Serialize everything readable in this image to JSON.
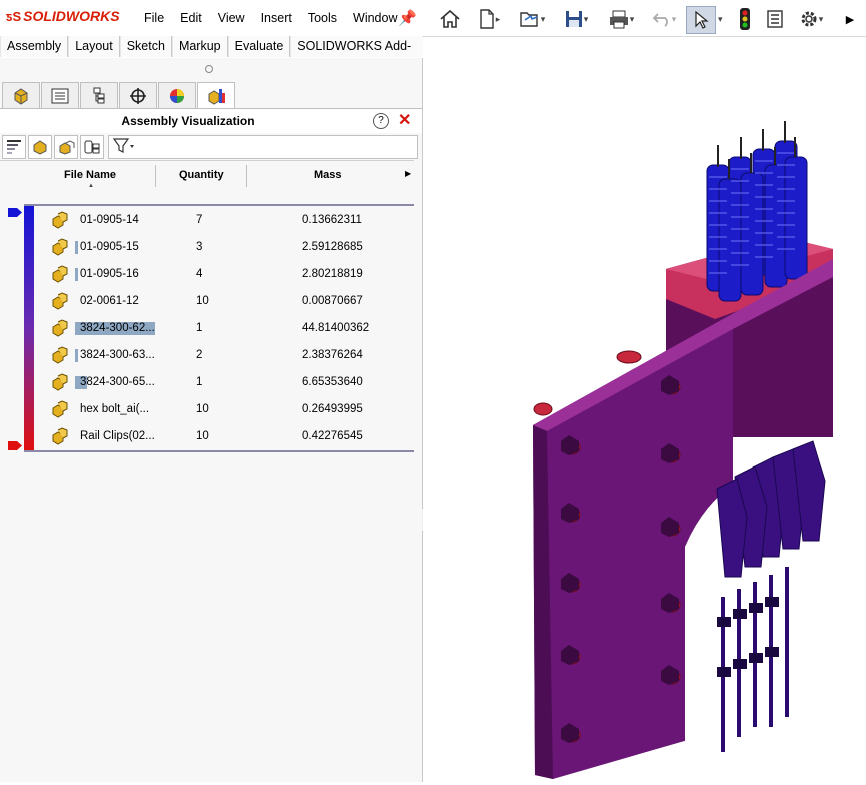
{
  "app": {
    "brand_prefix": "SOLID",
    "brand_suffix": "WORKS"
  },
  "menu": [
    "File",
    "Edit",
    "View",
    "Insert",
    "Tools",
    "Window"
  ],
  "command_tabs": [
    "Assembly",
    "Layout",
    "Sketch",
    "Markup",
    "Evaluate",
    "SOLIDWORKS Add-Ins"
  ],
  "toolbar_icons": [
    "home-icon",
    "new-document-icon",
    "open-icon",
    "save-icon",
    "print-icon",
    "undo-icon",
    "select-icon",
    "rebuild-traffic-light-icon",
    "file-properties-icon",
    "options-gear-icon",
    "more-arrow-icon"
  ],
  "panel": {
    "title": "Assembly Visualization",
    "help": "?",
    "close": "✕",
    "columns": {
      "name": "File Name",
      "quantity": "Quantity",
      "mass": "Mass"
    },
    "rows": [
      {
        "name": "01-0905-14",
        "quantity": "7",
        "mass": "0.13662311",
        "bar": 0
      },
      {
        "name": "01-0905-15",
        "quantity": "3",
        "mass": "2.59128685",
        "bar": 0.04
      },
      {
        "name": "01-0905-16",
        "quantity": "4",
        "mass": "2.80218819",
        "bar": 0.04
      },
      {
        "name": "02-0061-12",
        "quantity": "10",
        "mass": "0.00870667",
        "bar": 0
      },
      {
        "name": "3824-300-62...",
        "quantity": "1",
        "mass": "44.81400362",
        "bar": 1
      },
      {
        "name": "3824-300-63...",
        "quantity": "2",
        "mass": "2.38376264",
        "bar": 0.04
      },
      {
        "name": "3824-300-65...",
        "quantity": "1",
        "mass": "6.65353640",
        "bar": 0.15
      },
      {
        "name": "hex bolt_ai(...",
        "quantity": "10",
        "mass": "0.26493995",
        "bar": 0
      },
      {
        "name": "Rail Clips(02...",
        "quantity": "10",
        "mass": "0.42276545",
        "bar": 0
      }
    ]
  },
  "colors": {
    "gradient_top": "#1414d6",
    "gradient_bottom": "#e01010",
    "bar": "#8ea8c4",
    "close": "#d4140b"
  }
}
